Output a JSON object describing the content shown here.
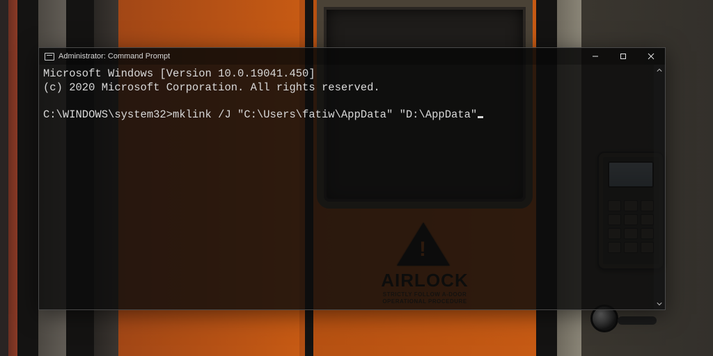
{
  "window": {
    "title": "Administrator: Command Prompt"
  },
  "terminal": {
    "line1": "Microsoft Windows [Version 10.0.19041.450]",
    "line2": "(c) 2020 Microsoft Corporation. All rights reserved.",
    "prompt_path": "C:\\WINDOWS\\system32>",
    "command": "mklink /J \"C:\\Users\\fatiw\\AppData\" \"D:\\AppData\""
  },
  "wallpaper": {
    "sign_title": "AIRLOCK",
    "sign_sub1": "STRICTLY FOLLOW A-DOOR",
    "sign_sub2": "OPERATIONAL PROCEDURE"
  }
}
